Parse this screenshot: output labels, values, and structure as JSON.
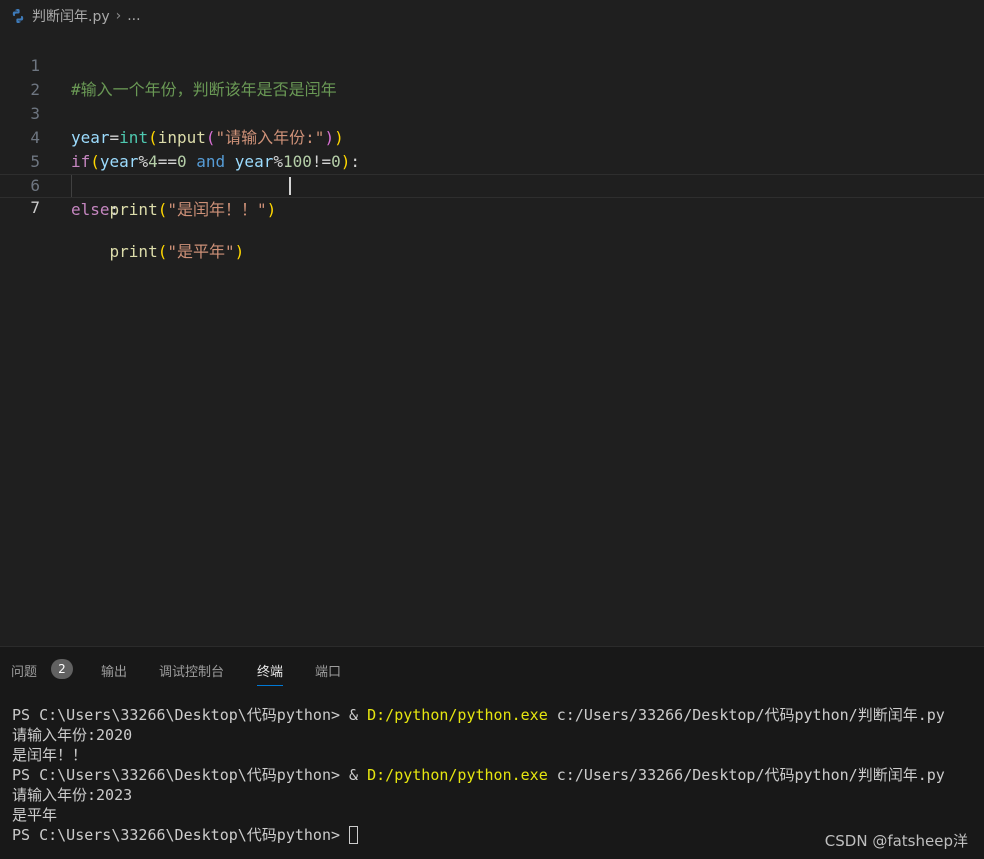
{
  "breadcrumb": {
    "file": "判断闰年.py",
    "more": "..."
  },
  "editor": {
    "line_numbers": [
      "1",
      "2",
      "3",
      "4",
      "5",
      "6",
      "7"
    ],
    "lines": {
      "l1": {
        "comment": "#输入一个年份，判断该年是否是闰年"
      },
      "l3": {
        "v1": "year",
        "op1": "=",
        "f1": "int",
        "p1": "(",
        "f2": "input",
        "p2": "(",
        "s1": "\"请输入年份:\"",
        "p3": ")",
        "p4": ")"
      },
      "l4": {
        "k1": "if",
        "p1": "(",
        "v1": "year",
        "o1": "%",
        "n1": "4",
        "o2": "==",
        "n2": "0",
        "and": " and ",
        "v2": "year",
        "o3": "%",
        "n3": "100",
        "o4": "!=",
        "n4": "0",
        "p2": ")",
        "colon": ":"
      },
      "l5": {
        "indent": "    ",
        "f1": "print",
        "p1": "(",
        "s1": "\"是闰年！！\"",
        "p2": ")"
      },
      "l6": {
        "k1": "else",
        "colon": ":"
      },
      "l7": {
        "indent": "    ",
        "f1": "print",
        "p1": "(",
        "s1": "\"是平年\"",
        "p2": ")"
      }
    }
  },
  "panel": {
    "tabs": [
      {
        "label": "问题"
      },
      {
        "label": "输出"
      },
      {
        "label": "调试控制台"
      },
      {
        "label": "终端"
      },
      {
        "label": "端口"
      }
    ],
    "problems_count": "2",
    "terminal": {
      "prompt": "PS C:\\Users\\33266\\Desktop\\代码python> ",
      "amp": "& ",
      "exe": "D:/python/python.exe",
      "script": " c:/Users/33266/Desktop/代码python/判断闰年.py",
      "in1": "请输入年份:2020",
      "out1": "是闰年！！",
      "in2": "请输入年份:2023",
      "out2": "是平年"
    }
  },
  "watermark": "CSDN @fatsheep洋",
  "colors": {
    "editor_bg": "#1f1f1f",
    "panel_bg": "#181818",
    "active_tab_underline": "#0078d4"
  },
  "icons": {
    "file": "python-icon",
    "breadcrumb_separator": "chevron-right-icon"
  }
}
